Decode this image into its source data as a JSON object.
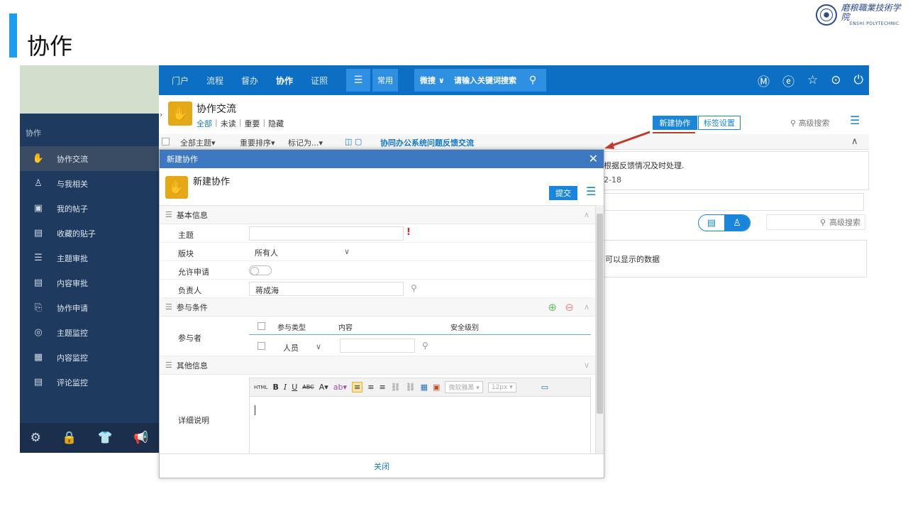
{
  "slide": {
    "title": "协作"
  },
  "logo": {
    "cn": "磨粮職業技術学院",
    "en": "ENSHI POLYTECHNIC"
  },
  "sidebar": {
    "section": "协作",
    "items": [
      {
        "label": "协作交流",
        "icon": "hand-icon",
        "glyph": "✋"
      },
      {
        "label": "与我相关",
        "icon": "user-icon",
        "glyph": "♙"
      },
      {
        "label": "我的帖子",
        "icon": "post-icon",
        "glyph": "▣"
      },
      {
        "label": "收藏的贴子",
        "icon": "bookmark-icon",
        "glyph": "▤"
      },
      {
        "label": "主题审批",
        "icon": "list-icon",
        "glyph": "☰"
      },
      {
        "label": "内容审批",
        "icon": "doc-icon",
        "glyph": "▤"
      },
      {
        "label": "协作申请",
        "icon": "clipboard-icon",
        "glyph": "⎘"
      },
      {
        "label": "主题监控",
        "icon": "monitor-icon",
        "glyph": "◎"
      },
      {
        "label": "内容监控",
        "icon": "doc-monitor-icon",
        "glyph": "▦"
      },
      {
        "label": "评论监控",
        "icon": "comment-monitor-icon",
        "glyph": "▤"
      }
    ],
    "bottom_icons": [
      "⚙",
      "🔒",
      "👕",
      "📢"
    ]
  },
  "topbar": {
    "nav": [
      "门户",
      "流程",
      "督办",
      "协作",
      "证照"
    ],
    "menu_glyph": "☰",
    "common_label": "常用",
    "search_type": "微搜 ∨",
    "search_placeholder": "请输入关键词搜索",
    "search_glyph": "⚲",
    "right_icons": [
      "Ⓜ",
      "ⓔ",
      "☆",
      "⊙",
      "⏻"
    ]
  },
  "page": {
    "title": "协作交流",
    "filters": [
      "全部",
      "未读",
      "重要",
      "隐藏"
    ],
    "new_button": "新建协作",
    "tag_button": "标签设置",
    "adv_search": "高级搜索",
    "toolbar": {
      "all_topics": "全部主题▾",
      "sort": "重要排序▾",
      "mark": "标记为...▾",
      "topic_link": "协同办公系统问题反馈交流"
    },
    "card1_text": "根据反馈情况及时处理.",
    "card1_date": "2-18",
    "adv_search2": "高级搜索",
    "card2_text": "可以显示的数据"
  },
  "modal": {
    "header": "新建协作",
    "close_glyph": "✕",
    "title": "新建协作",
    "submit": "提交",
    "sections": {
      "basic": "基本信息",
      "participate": "参与条件",
      "other": "其他信息"
    },
    "fields": {
      "subject_label": "主题",
      "subject_value": "",
      "required_mark": "!",
      "board_label": "版块",
      "board_value": "所有人",
      "allow_label": "允许申请",
      "owner_label": "负责人",
      "owner_value": "蒋成海",
      "participants_label": "参与者",
      "col_type": "参与类型",
      "col_content": "内容",
      "col_level": "安全级别",
      "type_value": "人员",
      "detail_label": "详细说明"
    },
    "editor": {
      "html": "HTML",
      "bold": "B",
      "italic": "I",
      "underline": "U",
      "strike": "ABC",
      "fontcolor": "A",
      "font": "微软雅黑",
      "size": "12px"
    },
    "footer_close": "关闭"
  },
  "colors": {
    "brand": "#0d6fc3",
    "sidebar": "#1e3a5f",
    "accent": "#e6a817",
    "arrow": "#c0392b"
  }
}
